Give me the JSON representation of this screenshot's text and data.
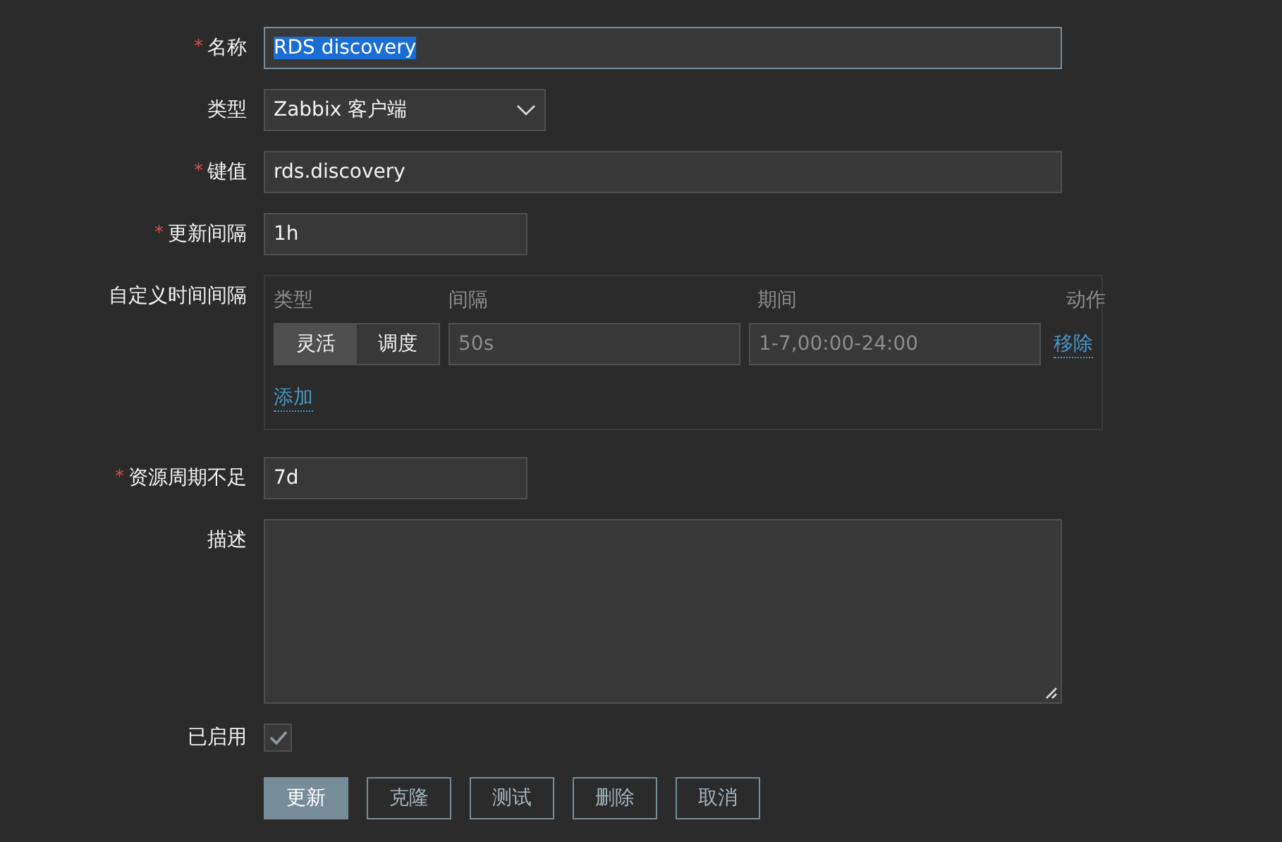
{
  "fields": [
    {
      "kind": "text",
      "label": "名称",
      "required": true,
      "value": "RDS discovery",
      "focused": true
    },
    {
      "kind": "select",
      "label": "类型",
      "required": false,
      "value": "Zabbix 客户端"
    },
    {
      "kind": "text",
      "label": "键值",
      "required": true,
      "value": "rds.discovery",
      "focused": false
    },
    {
      "kind": "duration",
      "label": "更新间隔",
      "required": true,
      "value": "1h",
      "focused": false
    },
    {
      "kind": "intervals",
      "label": "自定义时间间隔",
      "required": false,
      "columns": [
        "类型",
        "间隔",
        "期间",
        "动作"
      ],
      "rows": [
        {
          "type_options": [
            {
              "label": "灵活",
              "selected": true
            },
            {
              "label": "调度",
              "selected": false
            }
          ],
          "interval_placeholder": "50s",
          "period_placeholder": "1-7,00:00-24:00",
          "action": "移除"
        }
      ],
      "add_link": "添加"
    },
    {
      "kind": "duration",
      "label": "资源周期不足",
      "required": true,
      "value": "7d",
      "focused": false
    },
    {
      "kind": "textarea",
      "label": "描述",
      "required": false
    },
    {
      "kind": "checkbox",
      "label": "已启用",
      "required": false,
      "checked": true
    }
  ],
  "required_mark": "*",
  "buttons": [
    {
      "label": "更新",
      "primary": true
    },
    {
      "label": "克隆",
      "primary": false
    },
    {
      "label": "测试",
      "primary": false
    },
    {
      "label": "删除",
      "primary": false
    },
    {
      "label": "取消",
      "primary": false
    }
  ]
}
